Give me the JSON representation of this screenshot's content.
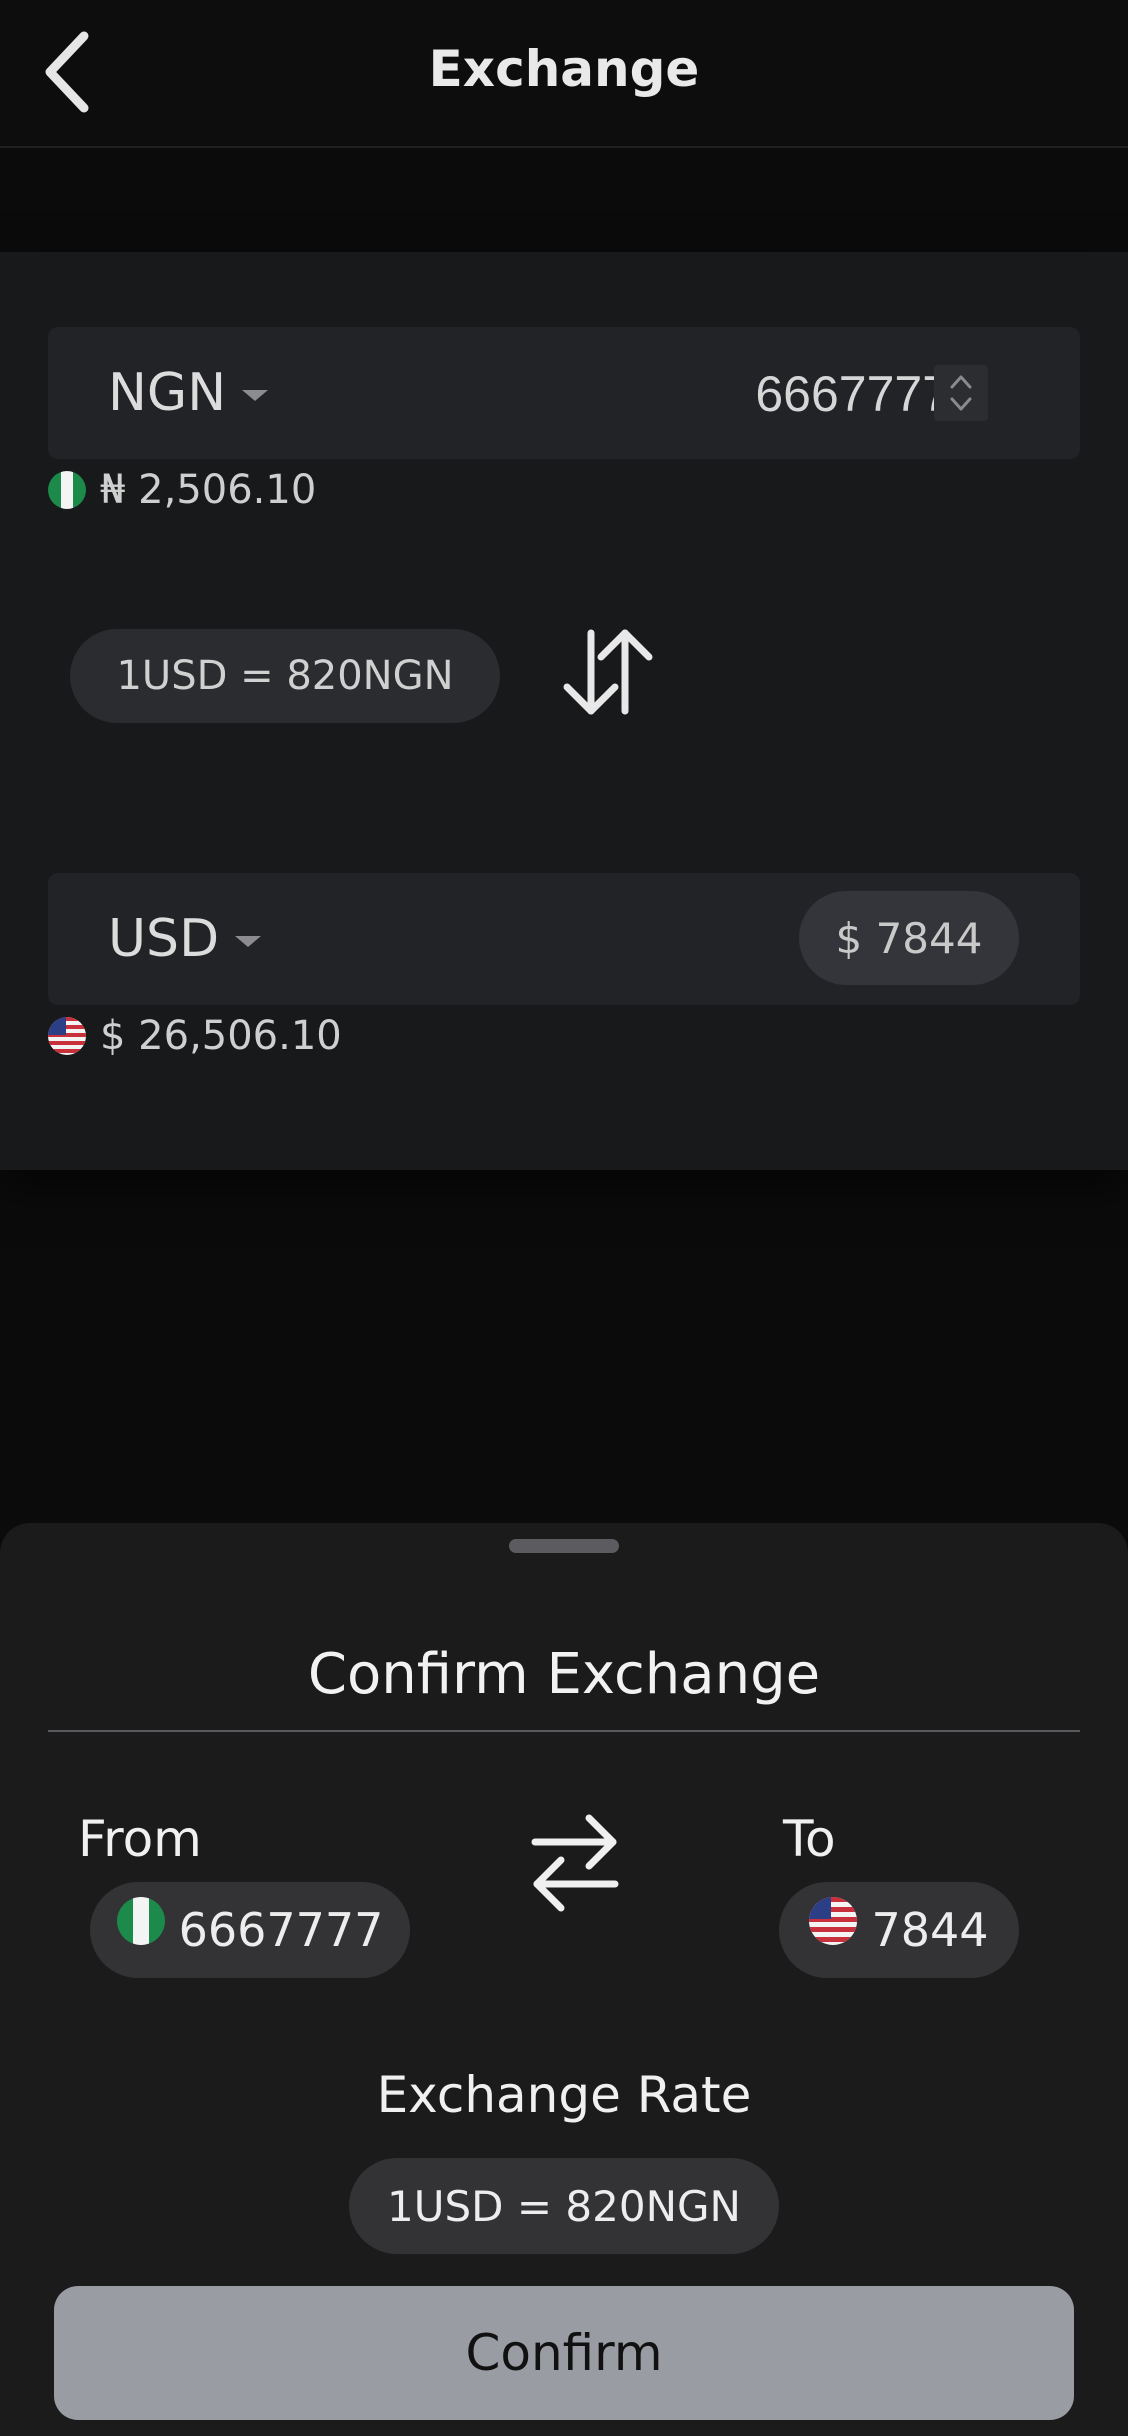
{
  "header": {
    "title": "Exchange",
    "back_icon": "chevron-left-icon"
  },
  "from_field": {
    "currency": "NGN",
    "amount": "6667777",
    "balance": "₦ 2,506.10",
    "flag": "nigeria-flag-icon"
  },
  "rate": {
    "text": "1USD = 820NGN",
    "swap_icon": "swap-vertical-icon"
  },
  "to_field": {
    "currency": "USD",
    "amount": "$ 7844",
    "balance": "$ 26,506.10",
    "flag": "usa-flag-icon"
  },
  "confirm_sheet": {
    "title": "Confirm Exchange",
    "from_label": "From",
    "from_amount": "6667777",
    "to_label": "To",
    "to_amount": "7844",
    "swap_icon": "swap-horizontal-icon",
    "rate_label": "Exchange Rate",
    "rate_value": "1USD = 820NGN",
    "confirm_label": "Confirm"
  },
  "colors": {
    "background": "#0b0b0c",
    "panel": "#18191b",
    "field": "#222327",
    "sheet": "#1b1b1c",
    "pill": "#333336",
    "confirm_button": "#9a9ca3"
  }
}
